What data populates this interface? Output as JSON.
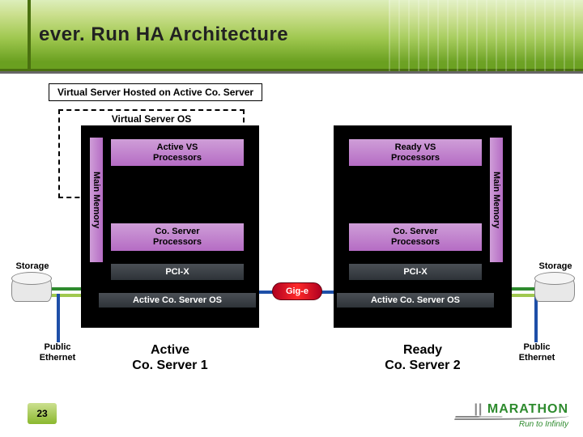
{
  "title": "ever. Run HA Architecture",
  "caption": "Virtual Server Hosted on Active Co. Server",
  "virtual_os_label": "Virtual Server OS",
  "memory_label": "Main Memory",
  "left": {
    "vs_proc": "Active VS\nProcessors",
    "co_proc": "Co. Server\nProcessors",
    "bus": "PCI-X",
    "os": "Active Co. Server OS",
    "name": "Active\nCo. Server 1"
  },
  "right": {
    "vs_proc": "Ready VS\nProcessors",
    "co_proc": "Co. Server\nProcessors",
    "bus": "PCI-X",
    "os": "Active Co. Server OS",
    "name": "Ready\nCo. Server 2"
  },
  "interconnect": "Gig-e",
  "storage_label": "Storage",
  "public_ethernet_label": "Public\nEthernet",
  "page_number": "23",
  "logo": {
    "brand": "MARATHON",
    "tagline": "Run to Infinity"
  }
}
